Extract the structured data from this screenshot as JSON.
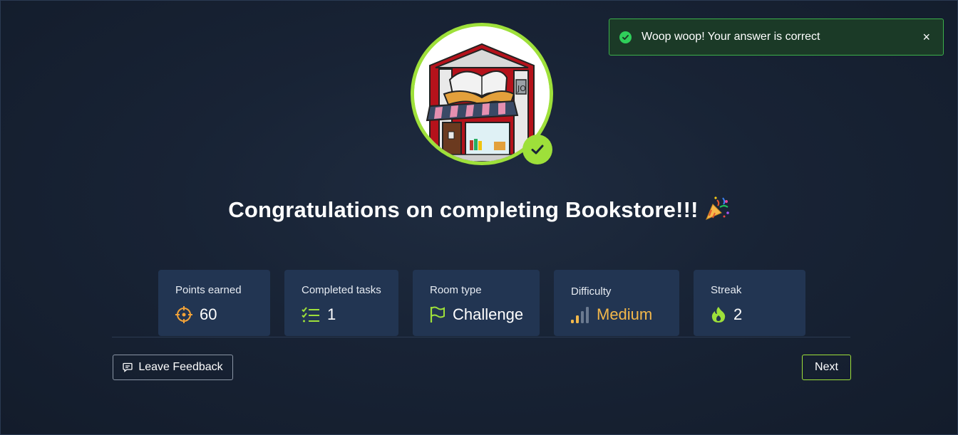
{
  "toast": {
    "message": "Woop woop! Your answer is correct",
    "close_symbol": "×",
    "icon": "check-circle-icon"
  },
  "room": {
    "avatar": "bookstore-illustration",
    "badge_icon": "checkmark-icon"
  },
  "title": {
    "text": "Congratulations on completing Bookstore!!!",
    "emoji_icon": "party-popper-icon"
  },
  "stats": {
    "points": {
      "label": "Points earned",
      "value": "60",
      "icon": "crosshair-icon"
    },
    "tasks": {
      "label": "Completed tasks",
      "value": "1",
      "icon": "checklist-icon"
    },
    "room_type": {
      "label": "Room type",
      "value": "Challenge",
      "icon": "flag-icon"
    },
    "difficulty": {
      "label": "Difficulty",
      "value": "Medium",
      "icon": "signal-bars-icon",
      "color": "#f3b84a"
    },
    "streak": {
      "label": "Streak",
      "value": "2",
      "icon": "flame-icon"
    }
  },
  "actions": {
    "feedback_label": "Leave Feedback",
    "next_label": "Next"
  },
  "colors": {
    "accent": "#9ee03a",
    "success": "#2fcf5a",
    "card_bg": "#223552",
    "page_bg": "#172233"
  }
}
